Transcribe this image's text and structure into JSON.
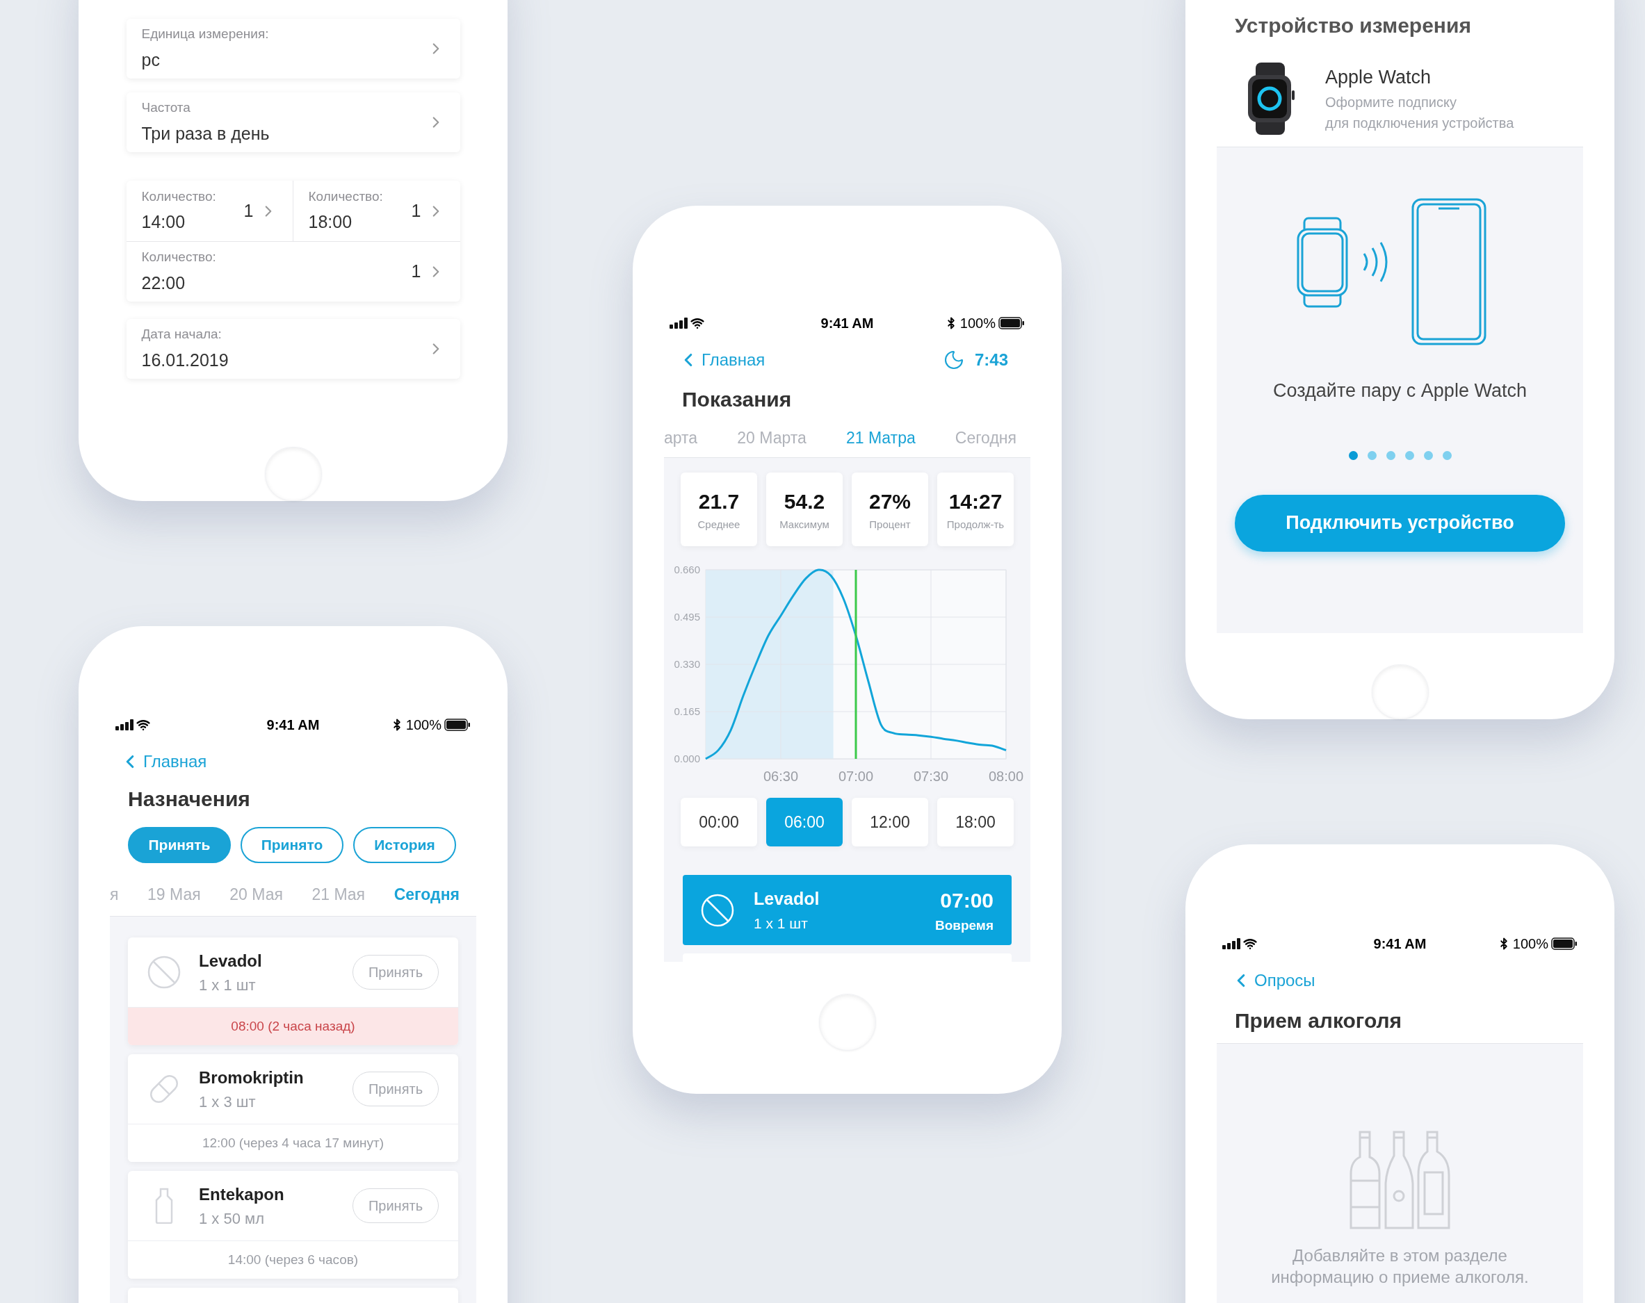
{
  "medication_settings": {
    "fields": [
      {
        "label": "Единица измерения:",
        "value": "pc"
      },
      {
        "label": "Частота",
        "value": "Три раза в день"
      }
    ],
    "doses": [
      {
        "label": "Количество:",
        "time": "14:00",
        "count": "1"
      },
      {
        "label": "Количество:",
        "time": "18:00",
        "count": "1"
      },
      {
        "label": "Количество:",
        "time": "22:00",
        "count": "1"
      }
    ],
    "start_date": {
      "label": "Дата начала:",
      "value": "16.01.2019"
    }
  },
  "prescriptions": {
    "status_bar": {
      "time": "9:41 AM",
      "battery": "100%"
    },
    "back": "Главная",
    "title": "Назначения",
    "filters": [
      {
        "label": "Принять",
        "selected": true
      },
      {
        "label": "Принято",
        "selected": false
      },
      {
        "label": "История",
        "selected": false
      }
    ],
    "dates": [
      {
        "label": "я",
        "selected": false
      },
      {
        "label": "19 Мая",
        "selected": false
      },
      {
        "label": "20 Мая",
        "selected": false
      },
      {
        "label": "21 Мая",
        "selected": false
      },
      {
        "label": "Сегодня",
        "selected": true
      }
    ],
    "items": [
      {
        "kind": "tablet",
        "name": "Levadol",
        "dose": "1 х 1 шт",
        "button": "Принять",
        "schedule": "08:00 (2 часа назад)",
        "overdue": true
      },
      {
        "kind": "capsule",
        "name": "Bromokriptin",
        "dose": "1 х 3 шт",
        "button": "Принять",
        "schedule": "12:00 (через 4 часа 17 минут)",
        "overdue": false
      },
      {
        "kind": "bottle",
        "name": "Entekapon",
        "dose": "1 х 50 мл",
        "button": "Принять",
        "schedule": "14:00 (через 6 часов)",
        "overdue": false
      }
    ]
  },
  "readings": {
    "status_bar": {
      "time": "9:41 AM",
      "battery": "100%"
    },
    "back": "Главная",
    "sleep": "7:43",
    "title": "Показания",
    "dates": [
      {
        "label": "арта",
        "selected": false
      },
      {
        "label": "20 Марта",
        "selected": false
      },
      {
        "label": "21 Матра",
        "selected": true
      },
      {
        "label": "Сегодня",
        "selected": false
      }
    ],
    "stats": [
      {
        "value": "21.7",
        "label": "Среднее"
      },
      {
        "value": "54.2",
        "label": "Максимум"
      },
      {
        "value": "27%",
        "label": "Процент"
      },
      {
        "value": "14:27",
        "label": "Продолж-ть"
      }
    ],
    "chart_data": {
      "type": "line",
      "categories": [
        null,
        null,
        null,
        null,
        null,
        null,
        "06:30",
        null,
        null,
        null,
        null,
        null,
        "07:00",
        null,
        null,
        null,
        null,
        null,
        "07:30",
        null,
        null,
        null,
        null,
        null,
        "08:00"
      ],
      "series": [
        {
          "color": "#12a5d9",
          "values": [
            0,
            0.03,
            0.1,
            0.22,
            0.33,
            0.43,
            0.5,
            0.57,
            0.63,
            0.66,
            0.64,
            0.56,
            0.43,
            0.27,
            0.12,
            0.09,
            0.085,
            0.082,
            0.077,
            0.07,
            0.064,
            0.056,
            0.049,
            0.045,
            0.03
          ]
        }
      ],
      "ylim": [
        0,
        0.66
      ],
      "grid": true,
      "yticks": [
        {
          "value": 0,
          "label": "0.000"
        },
        {
          "value": 0.165,
          "label": "0.165"
        },
        {
          "value": 0.33,
          "label": "0.330"
        },
        {
          "value": 0.495,
          "label": "0.495"
        },
        {
          "value": 0.66,
          "label": "0.660"
        }
      ]
    },
    "time_slots": [
      {
        "label": "00:00",
        "selected": false
      },
      {
        "label": "06:00",
        "selected": true
      },
      {
        "label": "12:00",
        "selected": false
      },
      {
        "label": "18:00",
        "selected": false
      }
    ],
    "event": {
      "kind": "tablet",
      "name": "Levadol",
      "dose": "1 х 1 шт",
      "time": "07:00",
      "status": "Вовремя"
    }
  },
  "device": {
    "title": "Устройство измерения",
    "name": "Apple Watch",
    "note_lines": [
      "Оформите подписку",
      "для подключения устройства"
    ],
    "caption": "Создайте пару с Apple Watch",
    "pager": [
      {
        "selected": true
      },
      {
        "selected": false
      },
      {
        "selected": false
      },
      {
        "selected": false
      },
      {
        "selected": false
      },
      {
        "selected": false
      }
    ],
    "button": "Подключить устройство"
  },
  "alcohol": {
    "status_bar": {
      "time": "9:41 AM",
      "battery": "100%"
    },
    "back": "Опросы",
    "title": "Прием алкоголя",
    "message": "Добавляйте в этом разделе информацию о приеме алкоголя."
  }
}
